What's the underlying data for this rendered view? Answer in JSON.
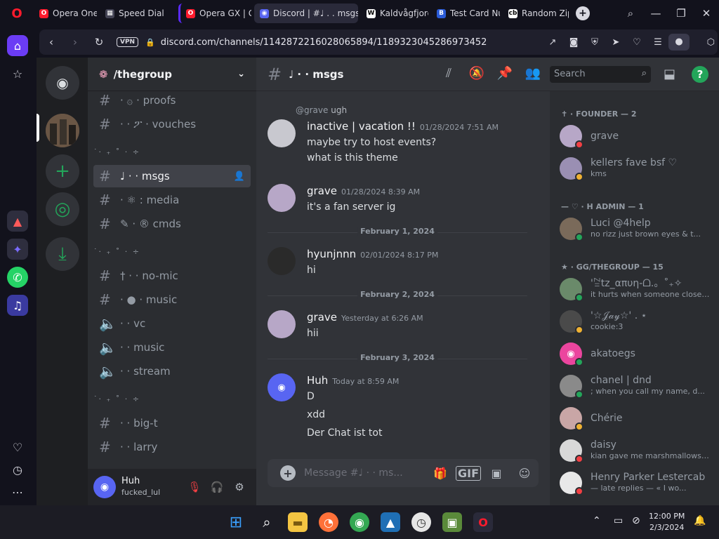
{
  "browser": {
    "tabs": [
      {
        "label": "Opera One",
        "favicon": "opera-icon",
        "color": "#ff1b2d"
      },
      {
        "label": "Speed Dial",
        "favicon": "grid-icon",
        "color": "#444455"
      },
      {
        "label": "Opera GX | G",
        "favicon": "opera-gx-icon",
        "color": "#ff1b2d"
      },
      {
        "label": "Discord | #♩ . . msgs",
        "favicon": "discord-icon",
        "color": "#5865f2"
      },
      {
        "label": "Kaldvågfjord",
        "favicon": "W",
        "color": "#ffffff"
      },
      {
        "label": "Test Card Nu",
        "favicon": "B",
        "color": "#2a5bd7"
      },
      {
        "label": "Random Zip",
        "favicon": "cb",
        "color": "#ffffff"
      }
    ],
    "url": "discord.com/channels/1142872216028065894/1189323045286973452",
    "vpn_label": "VPN"
  },
  "server": {
    "name": "/thegroup"
  },
  "channels": [
    {
      "name": "· ۞ · proofs",
      "type": "text"
    },
    {
      "name": "· · ፖ · vouches",
      "type": "text"
    },
    {
      "name": "♩ · · msgs",
      "type": "text",
      "selected": true
    },
    {
      "name": "· ⚛ : media",
      "type": "text"
    },
    {
      "name": "✎ · ® cmds",
      "type": "text"
    },
    {
      "name": "† · · no-mic",
      "type": "text"
    },
    {
      "name": "· ● · music",
      "type": "text"
    },
    {
      "name": "· · vc",
      "type": "voice"
    },
    {
      "name": "· · music",
      "type": "voice"
    },
    {
      "name": "· · stream",
      "type": "voice"
    },
    {
      "name": "· · big-t",
      "type": "text"
    },
    {
      "name": "· · larry",
      "type": "text"
    }
  ],
  "categories": [
    "˙‧ ₊ ˚ ‧ ÷",
    "˙‧ ₊ ˚ ‧ ÷",
    "˙‧ ₊ ˚ ‧ ÷"
  ],
  "user_panel": {
    "name": "Huh",
    "status": "fucked_lul"
  },
  "chat": {
    "channel_title": "♩ · · msgs",
    "search_placeholder": "Search",
    "composer_placeholder": "Message #♩ · · ms...",
    "gif_label": "GIF",
    "messages": [
      {
        "reply_at": "@grave",
        "reply_text": "ugh",
        "author": "inactive | vacation !!",
        "time": "01/28/2024 7:51 AM",
        "lines": [
          "maybe try to host events?",
          "what is this theme"
        ],
        "avatar_color": "#c8c8cf"
      },
      {
        "author": "grave",
        "time": "01/28/2024 8:39 AM",
        "lines": [
          "it's a fan server ig"
        ],
        "avatar_color": "#b7a7c7"
      },
      {
        "author": "hyunjnnn",
        "time": "02/01/2024 8:17 PM",
        "lines": [
          "hi"
        ],
        "avatar_color": "#2a2a2a"
      },
      {
        "author": "grave",
        "time": "Yesterday at 6:26 AM",
        "lines": [
          "hii"
        ],
        "avatar_color": "#b7a7c7"
      },
      {
        "author": "Huh",
        "time": "Today at 8:59 AM",
        "lines": [
          "D",
          "xdd",
          "Der Chat ist tot"
        ],
        "avatar_color": "#5865f2"
      }
    ],
    "dividers": [
      "February 1, 2024",
      "February 2, 2024",
      "February 3, 2024"
    ]
  },
  "members": {
    "groups": [
      "FOUNDER — 2",
      "H ADMIN — 1",
      "GG/THEGROUP — 15"
    ],
    "group_prefixes": [
      "✝ ·",
      "— ♡ ·",
      "★ ·"
    ],
    "list": [
      {
        "name": "grave",
        "status": "",
        "color": "#b7a7c7",
        "status_color": "#f23f43"
      },
      {
        "name": "kellers fave bsf ♡",
        "status": "kms",
        "color": "#9a8fb3",
        "status_color": "#f0b232"
      },
      {
        "name": "Luci @4help",
        "status": "no rizz just brown eyes & t...",
        "color": "#7a6a5a",
        "status_color": "#23a55a"
      },
      {
        "name": "'ꊂtz_απυη-ᗝ.。˚₊✧",
        "status": "it hurts when someone close t...",
        "color": "#6a8a6a",
        "status_color": "#23a55a"
      },
      {
        "name": "'☆𝒥𝒶𝓎☆' . ⋆",
        "status": "cookie:3",
        "color": "#4a4a4a",
        "status_color": "#f0b232"
      },
      {
        "name": "akatoegs",
        "status": "",
        "color": "#eb459e",
        "status_color": "#23a55a"
      },
      {
        "name": "chanel | dnd",
        "status": "; when you call my name, d...",
        "color": "#8a8a8a",
        "status_color": "#23a55a"
      },
      {
        "name": "Chérie",
        "status": "",
        "color": "#c9a6a6",
        "status_color": "#f0b232"
      },
      {
        "name": "daisy",
        "status": "kian gave me marshmallows :...",
        "color": "#d8d8d8",
        "status_color": "#f23f43"
      },
      {
        "name": "Henry Parker Lestercab",
        "status": "— late replies — « I wo...",
        "color": "#e8e8e8",
        "status_color": "#f23f43"
      }
    ]
  },
  "taskbar": {
    "time": "12:00 PM",
    "date": "2/3/2024"
  }
}
